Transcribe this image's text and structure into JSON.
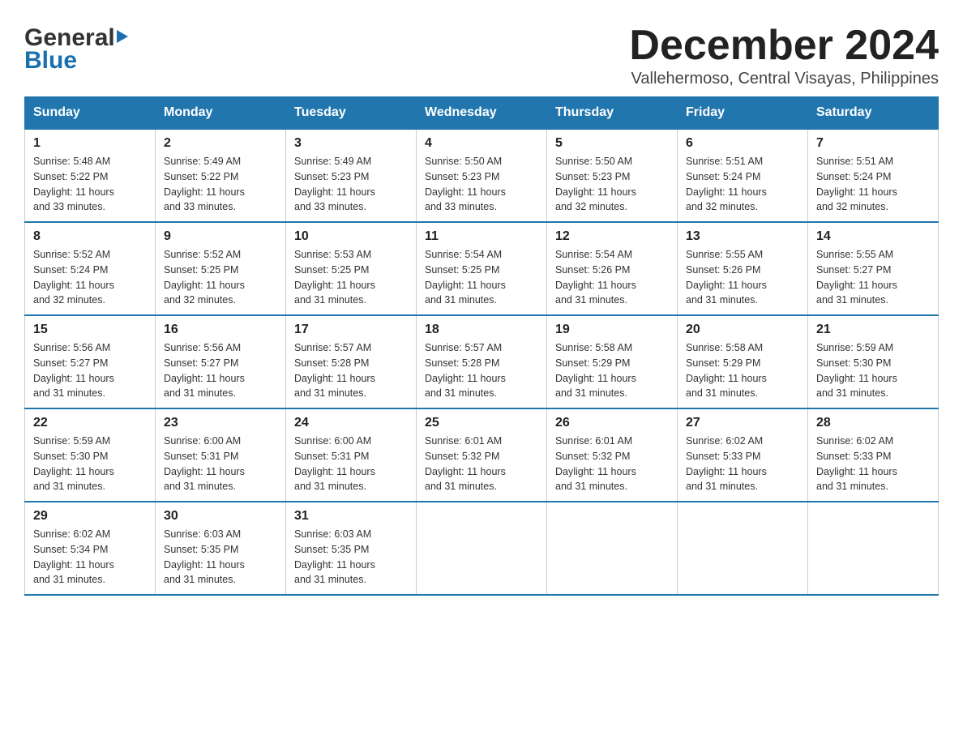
{
  "header": {
    "logo_general": "General",
    "logo_blue": "Blue",
    "month_title": "December 2024",
    "subtitle": "Vallehermoso, Central Visayas, Philippines"
  },
  "days_of_week": [
    "Sunday",
    "Monday",
    "Tuesday",
    "Wednesday",
    "Thursday",
    "Friday",
    "Saturday"
  ],
  "weeks": [
    [
      {
        "day": "1",
        "sunrise": "5:48 AM",
        "sunset": "5:22 PM",
        "daylight": "11 hours and 33 minutes."
      },
      {
        "day": "2",
        "sunrise": "5:49 AM",
        "sunset": "5:22 PM",
        "daylight": "11 hours and 33 minutes."
      },
      {
        "day": "3",
        "sunrise": "5:49 AM",
        "sunset": "5:23 PM",
        "daylight": "11 hours and 33 minutes."
      },
      {
        "day": "4",
        "sunrise": "5:50 AM",
        "sunset": "5:23 PM",
        "daylight": "11 hours and 33 minutes."
      },
      {
        "day": "5",
        "sunrise": "5:50 AM",
        "sunset": "5:23 PM",
        "daylight": "11 hours and 32 minutes."
      },
      {
        "day": "6",
        "sunrise": "5:51 AM",
        "sunset": "5:24 PM",
        "daylight": "11 hours and 32 minutes."
      },
      {
        "day": "7",
        "sunrise": "5:51 AM",
        "sunset": "5:24 PM",
        "daylight": "11 hours and 32 minutes."
      }
    ],
    [
      {
        "day": "8",
        "sunrise": "5:52 AM",
        "sunset": "5:24 PM",
        "daylight": "11 hours and 32 minutes."
      },
      {
        "day": "9",
        "sunrise": "5:52 AM",
        "sunset": "5:25 PM",
        "daylight": "11 hours and 32 minutes."
      },
      {
        "day": "10",
        "sunrise": "5:53 AM",
        "sunset": "5:25 PM",
        "daylight": "11 hours and 31 minutes."
      },
      {
        "day": "11",
        "sunrise": "5:54 AM",
        "sunset": "5:25 PM",
        "daylight": "11 hours and 31 minutes."
      },
      {
        "day": "12",
        "sunrise": "5:54 AM",
        "sunset": "5:26 PM",
        "daylight": "11 hours and 31 minutes."
      },
      {
        "day": "13",
        "sunrise": "5:55 AM",
        "sunset": "5:26 PM",
        "daylight": "11 hours and 31 minutes."
      },
      {
        "day": "14",
        "sunrise": "5:55 AM",
        "sunset": "5:27 PM",
        "daylight": "11 hours and 31 minutes."
      }
    ],
    [
      {
        "day": "15",
        "sunrise": "5:56 AM",
        "sunset": "5:27 PM",
        "daylight": "11 hours and 31 minutes."
      },
      {
        "day": "16",
        "sunrise": "5:56 AM",
        "sunset": "5:27 PM",
        "daylight": "11 hours and 31 minutes."
      },
      {
        "day": "17",
        "sunrise": "5:57 AM",
        "sunset": "5:28 PM",
        "daylight": "11 hours and 31 minutes."
      },
      {
        "day": "18",
        "sunrise": "5:57 AM",
        "sunset": "5:28 PM",
        "daylight": "11 hours and 31 minutes."
      },
      {
        "day": "19",
        "sunrise": "5:58 AM",
        "sunset": "5:29 PM",
        "daylight": "11 hours and 31 minutes."
      },
      {
        "day": "20",
        "sunrise": "5:58 AM",
        "sunset": "5:29 PM",
        "daylight": "11 hours and 31 minutes."
      },
      {
        "day": "21",
        "sunrise": "5:59 AM",
        "sunset": "5:30 PM",
        "daylight": "11 hours and 31 minutes."
      }
    ],
    [
      {
        "day": "22",
        "sunrise": "5:59 AM",
        "sunset": "5:30 PM",
        "daylight": "11 hours and 31 minutes."
      },
      {
        "day": "23",
        "sunrise": "6:00 AM",
        "sunset": "5:31 PM",
        "daylight": "11 hours and 31 minutes."
      },
      {
        "day": "24",
        "sunrise": "6:00 AM",
        "sunset": "5:31 PM",
        "daylight": "11 hours and 31 minutes."
      },
      {
        "day": "25",
        "sunrise": "6:01 AM",
        "sunset": "5:32 PM",
        "daylight": "11 hours and 31 minutes."
      },
      {
        "day": "26",
        "sunrise": "6:01 AM",
        "sunset": "5:32 PM",
        "daylight": "11 hours and 31 minutes."
      },
      {
        "day": "27",
        "sunrise": "6:02 AM",
        "sunset": "5:33 PM",
        "daylight": "11 hours and 31 minutes."
      },
      {
        "day": "28",
        "sunrise": "6:02 AM",
        "sunset": "5:33 PM",
        "daylight": "11 hours and 31 minutes."
      }
    ],
    [
      {
        "day": "29",
        "sunrise": "6:02 AM",
        "sunset": "5:34 PM",
        "daylight": "11 hours and 31 minutes."
      },
      {
        "day": "30",
        "sunrise": "6:03 AM",
        "sunset": "5:35 PM",
        "daylight": "11 hours and 31 minutes."
      },
      {
        "day": "31",
        "sunrise": "6:03 AM",
        "sunset": "5:35 PM",
        "daylight": "11 hours and 31 minutes."
      },
      null,
      null,
      null,
      null
    ]
  ],
  "labels": {
    "sunrise": "Sunrise:",
    "sunset": "Sunset:",
    "daylight": "Daylight:"
  }
}
